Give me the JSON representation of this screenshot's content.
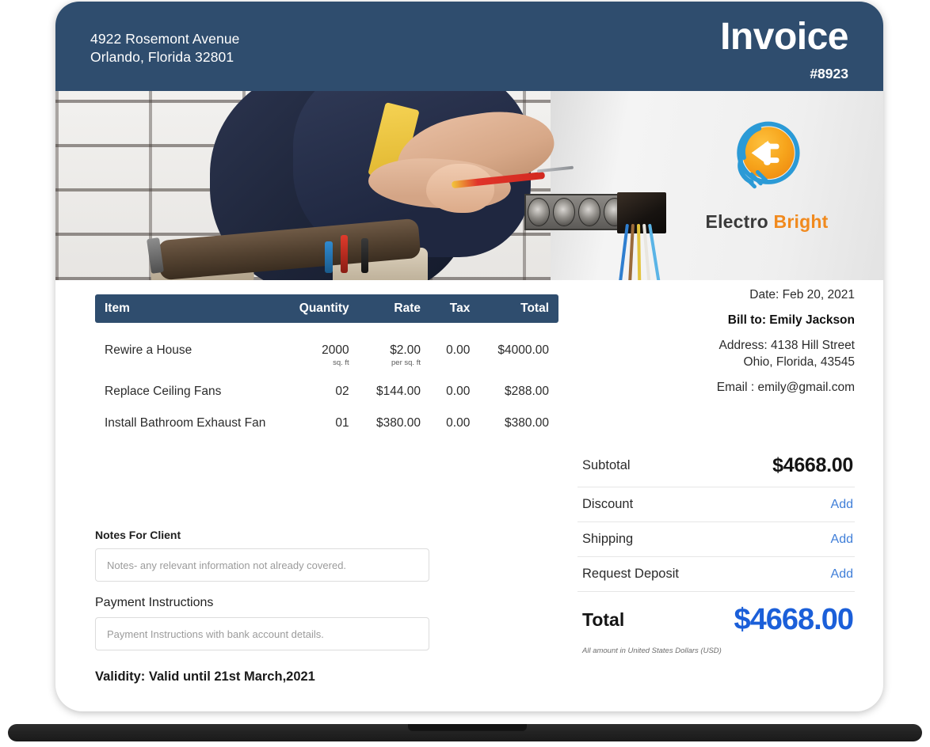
{
  "header": {
    "address_line1": "4922 Rosemont Avenue",
    "address_line2": "Orlando, Florida 32801",
    "title": "Invoice",
    "number": "#8923"
  },
  "hero": {
    "photo_alt": "electrician-wiring-wall-outlets-photo",
    "logo": {
      "name_primary": "Electro",
      "name_secondary": "Bright",
      "mark": "lightbulb-plug-icon"
    }
  },
  "items": {
    "columns": [
      "Item",
      "Quantity",
      "Rate",
      "Tax",
      "Total"
    ],
    "rows": [
      {
        "item": "Rewire a House",
        "quantity": "2000",
        "quantity_unit": "sq. ft",
        "rate": "$2.00",
        "rate_unit": "per sq. ft",
        "tax": "0.00",
        "total": "$4000.00"
      },
      {
        "item": "Replace Ceiling Fans",
        "quantity": "02",
        "quantity_unit": "",
        "rate": "$144.00",
        "rate_unit": "",
        "tax": "0.00",
        "total": "$288.00"
      },
      {
        "item": "Install Bathroom Exhaust Fan",
        "quantity": "01",
        "quantity_unit": "",
        "rate": "$380.00",
        "rate_unit": "",
        "tax": "0.00",
        "total": "$380.00"
      }
    ]
  },
  "notes": {
    "notes_label": "Notes For Client",
    "notes_value": "",
    "notes_placeholder": "Notes- any relevant information not already covered.",
    "payment_label": "Payment Instructions",
    "payment_value": "",
    "payment_placeholder": "Payment Instructions with bank account details.",
    "validity": "Validity: Valid until 21st March,2021"
  },
  "meta": {
    "date": "Date: Feb 20, 2021",
    "bill_to": "Bill to: Emily Jackson",
    "address_line1": "Address: 4138 Hill Street",
    "address_line2": "Ohio, Florida, 43545",
    "email": "Email : emily@gmail.com"
  },
  "totals": {
    "subtotal_label": "Subtotal",
    "subtotal_value": "$4668.00",
    "discount_label": "Discount",
    "discount_action": "Add",
    "shipping_label": "Shipping",
    "shipping_action": "Add",
    "deposit_label": "Request Deposit",
    "deposit_action": "Add",
    "total_label": "Total",
    "total_value": "$4668.00",
    "currency_note": "All amount in United States Dollars (USD)"
  },
  "colors": {
    "header_navy": "#2F4D6E",
    "link_blue": "#3F7ED8",
    "total_blue": "#1B5FD9",
    "logo_orange": "#F18A1E",
    "logo_blue": "#2B9AD6"
  }
}
